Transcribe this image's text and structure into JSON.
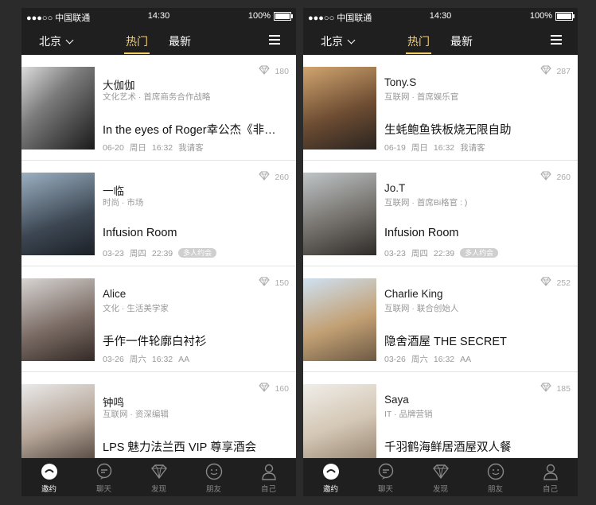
{
  "screens": [
    {
      "status": {
        "carrier": "●●●○○ 中国联通",
        "time": "14:30",
        "battery": "100%"
      },
      "nav": {
        "city": "北京",
        "tab_hot": "热门",
        "tab_new": "最新"
      },
      "cards": [
        {
          "name": "大伽伽",
          "role": "文化艺术 · 首席商务合作战略",
          "title": "In the eyes of Roger幸公杰《非…",
          "date": "06-20",
          "weekday": "周日",
          "time": "16:32",
          "extra": "我请客",
          "tag": "",
          "count": "180"
        },
        {
          "name": "一临",
          "role": "时尚 · 市场",
          "title": "Infusion Room",
          "date": "03-23",
          "weekday": "周四",
          "time": "22:39",
          "extra": "",
          "tag": "多人约会",
          "count": "260"
        },
        {
          "name": "Alice",
          "role": "文化 · 生活美学家",
          "title": "手作一件轮廓白衬衫",
          "date": "03-26",
          "weekday": "周六",
          "time": "16:32",
          "extra": "AA",
          "tag": "",
          "count": "150"
        },
        {
          "name": "钟鸣",
          "role": "互联网 · 资深编辑",
          "title": "LPS 魅力法兰西 VIP 尊享酒会",
          "date": "",
          "weekday": "",
          "time": "",
          "extra": "",
          "tag": "",
          "count": "160"
        }
      ],
      "tabbar": [
        "邀约",
        "聊天",
        "发现",
        "朋友",
        "自己"
      ]
    },
    {
      "status": {
        "carrier": "●●●○○ 中国联通",
        "time": "14:30",
        "battery": "100%"
      },
      "nav": {
        "city": "北京",
        "tab_hot": "热门",
        "tab_new": "最新"
      },
      "cards": [
        {
          "name": "Tony.S",
          "role": "互联网 · 首席娱乐官",
          "title": "生蚝鲍鱼铁板烧无限自助",
          "date": "06-19",
          "weekday": "周日",
          "time": "16:32",
          "extra": "我请客",
          "tag": "",
          "count": "287"
        },
        {
          "name": "Jo.T",
          "role": "互联网 · 首席Bi格官 : )",
          "title": "Infusion Room",
          "date": "03-23",
          "weekday": "周四",
          "time": "22:39",
          "extra": "",
          "tag": "多人约会",
          "count": "260"
        },
        {
          "name": "Charlie King",
          "role": "互联网 · 联合创始人",
          "title": "隐舍酒屋 THE SECRET",
          "date": "03-26",
          "weekday": "周六",
          "time": "16:32",
          "extra": "AA",
          "tag": "",
          "count": "252"
        },
        {
          "name": "Saya",
          "role": "IT · 品牌营销",
          "title": "千羽鹤海鲜居酒屋双人餐",
          "date": "",
          "weekday": "",
          "time": "",
          "extra": "",
          "tag": "",
          "count": "185"
        }
      ],
      "tabbar": [
        "邀约",
        "聊天",
        "发现",
        "朋友",
        "自己"
      ]
    }
  ],
  "colors": {
    "accent": "#f7d068",
    "bar": "#1f1f1f",
    "bg": "#2b2b2b"
  }
}
